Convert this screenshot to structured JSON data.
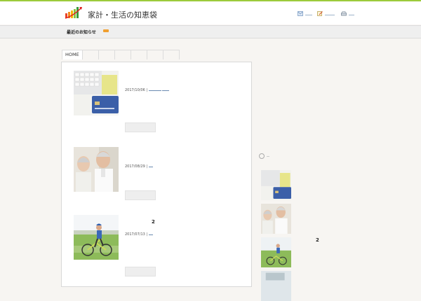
{
  "header": {
    "title": "家計・生活の知恵袋",
    "links": [
      {
        "icon": "mail-icon"
      },
      {
        "icon": "edit-icon"
      },
      {
        "icon": "print-icon"
      }
    ]
  },
  "newsbar": {
    "label": "最近のお知らせ",
    "rss_icon": "rss-icon"
  },
  "nav": {
    "tabs": [
      "HOME",
      "",
      "",
      "",
      "",
      "",
      ""
    ]
  },
  "posts": [
    {
      "date": "2017/10/06 |",
      "title": "",
      "thumb": "credit-card-keyboard-image"
    },
    {
      "date": "2017/08/29 |",
      "title": "",
      "thumb": "elderly-couple-image"
    },
    {
      "date": "2017/07/13 |",
      "title": "2",
      "thumb": "child-bicycle-image"
    }
  ],
  "sidebar": {
    "items": [
      {
        "title": "",
        "thumb": "credit-card-keyboard-image"
      },
      {
        "title": "",
        "thumb": "elderly-couple-image"
      },
      {
        "title": "2",
        "thumb": "child-bicycle-image"
      },
      {
        "title": "",
        "thumb": "office-image"
      }
    ]
  },
  "colors": {
    "accent_green": "#9ccb3b",
    "link_blue": "#6a8ab0"
  }
}
